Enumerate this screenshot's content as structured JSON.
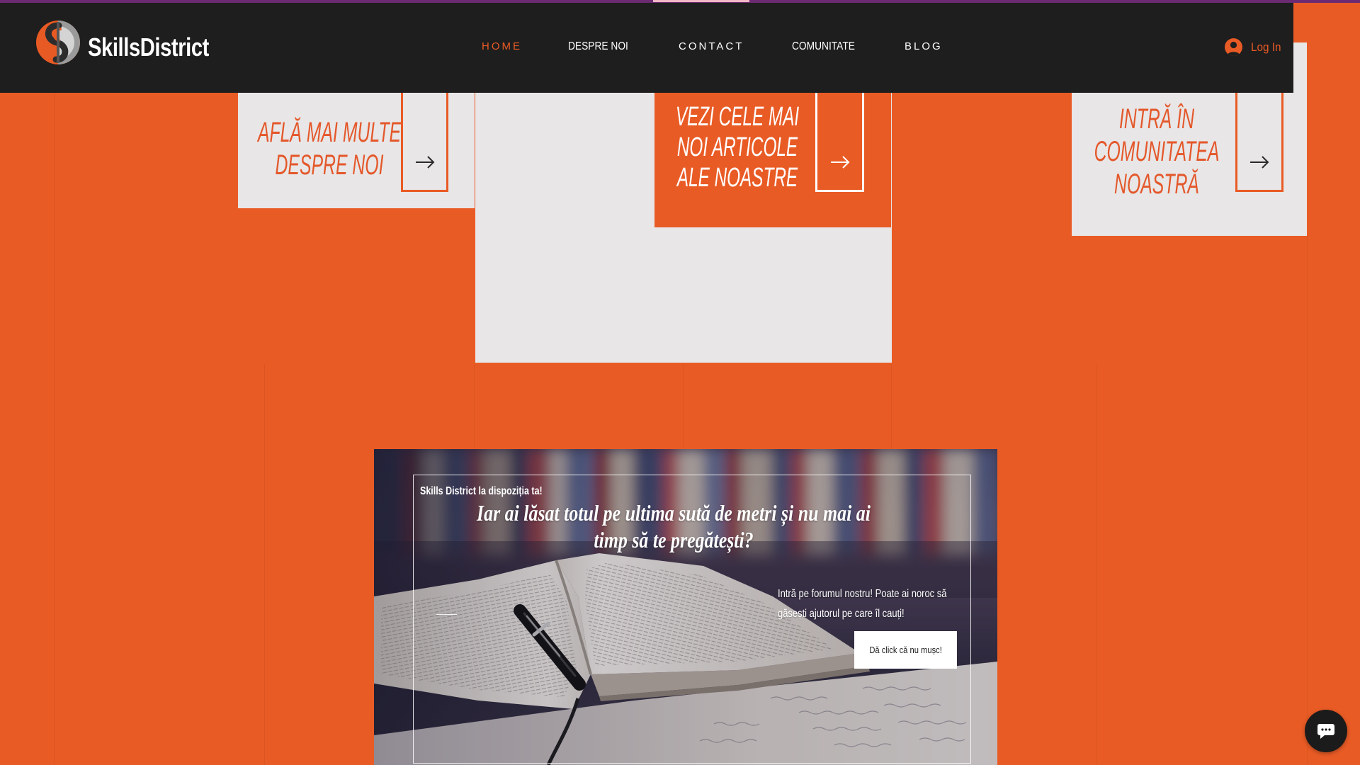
{
  "brand": {
    "name": "SkillsDistrict"
  },
  "nav": {
    "items": [
      {
        "label": "HOME",
        "active": true
      },
      {
        "label": "DESPRE NOI",
        "active": false
      },
      {
        "label": "CONTACT",
        "active": false
      },
      {
        "label": "COMUNITATE",
        "active": false
      },
      {
        "label": "BLOG",
        "active": false
      }
    ]
  },
  "auth": {
    "login_label": "Log In"
  },
  "cards": [
    {
      "lines": [
        "AFLĂ MAI MULTE",
        "DESPRE NOI"
      ]
    },
    {
      "lines": [
        "VEZI CELE MAI",
        "NOI ARTICOLE",
        "ALE NOASTRE"
      ]
    },
    {
      "lines": [
        "INTRĂ ÎN",
        "COMUNITATEA",
        "NOASTRĂ"
      ]
    }
  ],
  "banner": {
    "eyebrow": "Skills District la dispoziția ta!",
    "heading_lines": [
      "Iar ai lăsat totul pe ultima sută de metri și nu mai ai",
      "timp să te pregătești?"
    ],
    "text_lines": [
      "Intră pe forumul nostru! Poate ai noroc să",
      "găsești ajutorul pe care îl cauți!"
    ],
    "button_label": "Dă click că nu mușc!"
  },
  "icons": {
    "logo": "skillsdistrict-logo-icon",
    "login": "user-icon",
    "card_arrow": "arrow-right-icon",
    "chat": "chat-bubble-icon"
  },
  "colors": {
    "accent": "#E95B25",
    "header_bg": "#1E1E1E",
    "card_bg": "#E8E6E6",
    "top_bar": "#6B2A72",
    "card_text": "#E4572A",
    "text_light": "#FFFFFF",
    "chat_bg": "#1B1B1B"
  }
}
